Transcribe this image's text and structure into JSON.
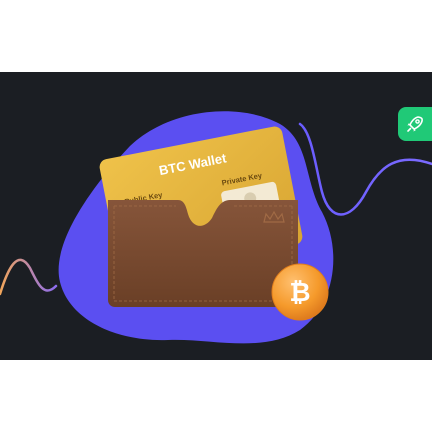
{
  "card": {
    "title": "BTC Wallet",
    "public_key_label": "Public Key",
    "private_key_label": "Private Key"
  },
  "icons": {
    "coin": "bitcoin-icon",
    "badge": "rocket-icon",
    "crown": "crown-icon"
  },
  "colors": {
    "background": "#1b1e23",
    "blob": "#5b4ff1",
    "card_gold": "#e0b33b",
    "wallet_leather": "#7a4a2e",
    "coin_orange": "#f59a2b",
    "badge_green": "#20c977",
    "wave_gradient_start": "#f2a65a",
    "wave_gradient_end": "#6a5cff"
  }
}
